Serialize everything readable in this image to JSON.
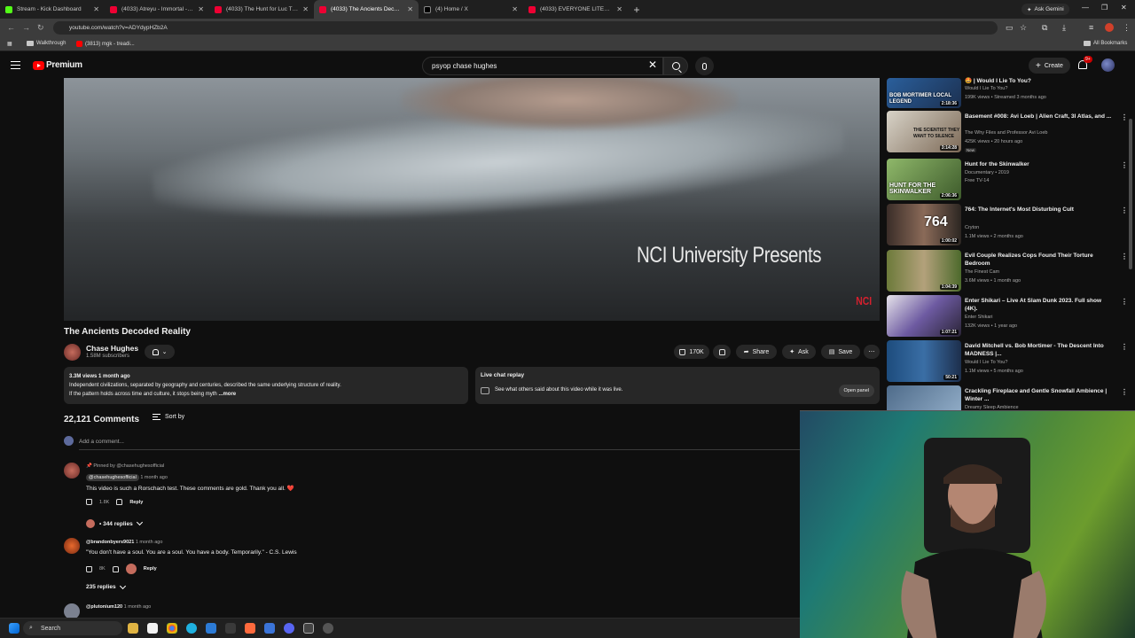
{
  "browser": {
    "tabs": [
      {
        "title": "Stream - Kick Dashboard",
        "icon": "kick-icon",
        "active": false
      },
      {
        "title": "(4033) Atreyu - Immortal - Yo...",
        "icon": "youtube-icon",
        "active": false
      },
      {
        "title": "(4033) The Hunt for Luc The In...",
        "icon": "youtube-icon",
        "active": false
      },
      {
        "title": "(4033) The Ancients Decoded R...",
        "icon": "youtube-icon",
        "active": true
      },
      {
        "title": "(4) Home / X",
        "icon": "x-icon",
        "active": false
      },
      {
        "title": "(4033) EVERYONE LITERALLY CI...",
        "icon": "youtube-icon",
        "active": false
      }
    ],
    "ask_gemini": "Ask Gemini",
    "url": "youtube.com/watch?v=ADYdypHZb2A",
    "bookmarks": [
      "Walkthrough",
      "(3813) mgk - treadi..."
    ],
    "all_bookmarks": "All Bookmarks"
  },
  "header": {
    "brand": "Premium",
    "search_query": "psyop chase hughes",
    "create": "Create",
    "notif_count": "9+"
  },
  "video": {
    "overlay_text": "NCI University Presents",
    "overlay_mark": "NCI",
    "title": "The Ancients Decoded Reality",
    "channel": "Chase Hughes",
    "subscribers": "1.58M subscribers",
    "likes": "170K",
    "share": "Share",
    "ask": "Ask",
    "save": "Save"
  },
  "description": {
    "meta": "3.3M views  1 month ago",
    "line1": "Independent civilizations, separated by geography and centuries, described the same underlying structure of reality.",
    "line2": "If the pattern holds across time and culture, it stops being myth",
    "more": "...more"
  },
  "live_chat": {
    "title": "Live chat replay",
    "subtitle": "See what others said about this video while it was live.",
    "button": "Open panel"
  },
  "comments": {
    "count": "22,121 Comments",
    "sort": "Sort by",
    "add_placeholder": "Add a comment...",
    "items": [
      {
        "pinned": "Pinned by @chasehughesofficial",
        "author": "@chasehughesofficial",
        "time": "1 month ago",
        "text": "This video is such a Rorschach test. These comments are gold. Thank you all. ❤️",
        "likes": "1.8K",
        "reply": "Reply",
        "replies": "• 344 replies"
      },
      {
        "author": "@brandonbyers9021",
        "time": "1 month ago",
        "text": "\"You don't have a soul. You are a soul. You have a body. Temporarily.\" - C.S. Lewis",
        "likes": "8K",
        "reply": "Reply",
        "replies": "235 replies"
      },
      {
        "author": "@plutonium120",
        "time": "1 month ago",
        "text": ""
      }
    ]
  },
  "recommendations": [
    {
      "title": "| Would I Lie To You?",
      "channel": "Would I Lie To You?",
      "meta": "199K views • Streamed 3 months ago",
      "duration": "2:18:36",
      "overlay": "BOB MORTIMER LOCAL LEGEND",
      "badge": ""
    },
    {
      "title": "Basement #008: Avi Loeb | Alien Craft, 3I Atlas, and ...",
      "channel": "The Why Files and Professor Avi Loeb",
      "meta": "425K views • 20 hours ago",
      "duration": "3:14:28",
      "overlay": "THE SCIENTIST THEY WANT TO SILENCE",
      "badge": "New"
    },
    {
      "title": "Hunt for the Skinwalker",
      "channel": "Documentary • 2019",
      "meta": "Free  TV-14",
      "duration": "2:06:36",
      "overlay": "HUNT FOR THE SKINWALKER",
      "badge": ""
    },
    {
      "title": "764: The Internet's Most Disturbing Cult",
      "channel": "Cryton",
      "meta": "1.1M views • 2 months ago",
      "duration": "1:00:02",
      "overlay": "764",
      "badge": ""
    },
    {
      "title": "Evil Couple Realizes Cops Found Their Torture Bedroom",
      "channel": "The Finest Cam",
      "meta": "3.6M views • 1 month ago",
      "duration": "1:04:39",
      "overlay": "",
      "badge": ""
    },
    {
      "title": "Enter Shikari – Live At Slam Dunk 2023. Full show (4K).",
      "channel": "Enter Shikari",
      "meta": "132K views • 1 year ago",
      "duration": "1:07:21",
      "overlay": "",
      "badge": ""
    },
    {
      "title": "David Mitchell vs. Bob Mortimer - The Descent Into MADNESS |...",
      "channel": "Would I Lie To You?",
      "meta": "1.1M views • 5 months ago",
      "duration": "50:21",
      "overlay": "",
      "badge": ""
    },
    {
      "title": "Crackling Fireplace and Gentle Snowfall Ambience | Winter ...",
      "channel": "Dreamy Sleep Ambience",
      "meta": "",
      "duration": "",
      "overlay": "",
      "badge": ""
    }
  ],
  "taskbar": {
    "search": "Search"
  }
}
